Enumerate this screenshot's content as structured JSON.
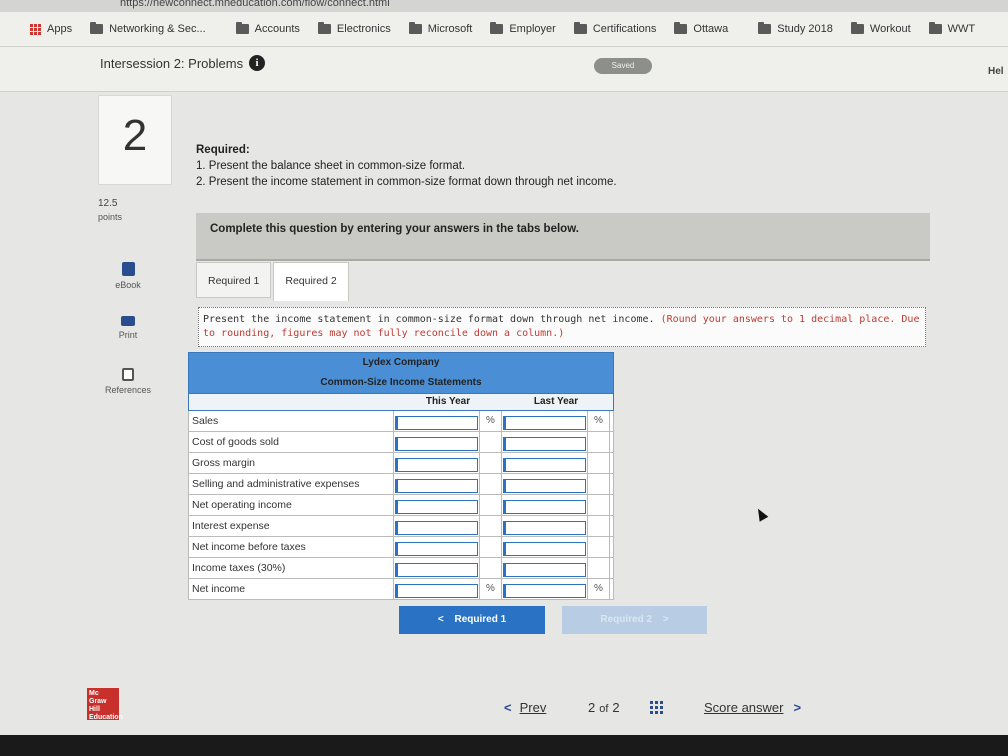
{
  "browser": {
    "url_fragment": "https://newconnect.mheducation.com/flow/connect.html",
    "bookmarks": [
      "Apps",
      "Networking & Sec...",
      "Accounts",
      "Electronics",
      "Microsoft",
      "Employer",
      "Certifications",
      "Ottawa",
      "Study 2018",
      "Workout",
      "WWT"
    ]
  },
  "header": {
    "title": "Intersession 2: Problems",
    "info_glyph": "i",
    "saved_label": "Saved",
    "help_label": "Hel"
  },
  "question": {
    "number": "2",
    "points_value": "12.5",
    "points_label": "points"
  },
  "tools": [
    {
      "label": "eBook",
      "icon": "ebook-icon"
    },
    {
      "label": "Print",
      "icon": "print-icon"
    },
    {
      "label": "References",
      "icon": "references-icon"
    }
  ],
  "required": {
    "heading": "Required:",
    "items": [
      "1. Present the balance sheet in common-size format.",
      "2. Present the income statement in common-size format down through net income."
    ]
  },
  "banner": "Complete this question by entering your answers in the tabs below.",
  "tabs": [
    "Required 1",
    "Required 2"
  ],
  "instruction": {
    "main": "Present the income statement in common-size format down through net income.",
    "note": "(Round your answers to 1 decimal place. Due to rounding, figures may not fully reconcile down a column.)"
  },
  "table": {
    "company": "Lydex Company",
    "title": "Common-Size Income Statements",
    "col_this_year": "This Year",
    "col_last_year": "Last Year",
    "pct_symbol": "%",
    "rows": [
      {
        "label": "Sales",
        "this_year": "",
        "last_year": "",
        "this_pct": "%",
        "last_pct": "%"
      },
      {
        "label": "Cost of goods sold",
        "this_year": "",
        "last_year": "",
        "this_pct": "",
        "last_pct": ""
      },
      {
        "label": "Gross margin",
        "this_year": "",
        "last_year": "",
        "this_pct": "",
        "last_pct": ""
      },
      {
        "label": "Selling and administrative expenses",
        "this_year": "",
        "last_year": "",
        "this_pct": "",
        "last_pct": ""
      },
      {
        "label": "Net operating income",
        "this_year": "",
        "last_year": "",
        "this_pct": "",
        "last_pct": ""
      },
      {
        "label": "Interest expense",
        "this_year": "",
        "last_year": "",
        "this_pct": "",
        "last_pct": ""
      },
      {
        "label": "Net income before taxes",
        "this_year": "",
        "last_year": "",
        "this_pct": "",
        "last_pct": ""
      },
      {
        "label": "Income taxes (30%)",
        "this_year": "",
        "last_year": "",
        "this_pct": "",
        "last_pct": ""
      },
      {
        "label": "Net income",
        "this_year": "",
        "last_year": "",
        "this_pct": "%",
        "last_pct": "%"
      }
    ]
  },
  "buttons": {
    "prev_tab": "Required 1",
    "next_tab": "Required 2"
  },
  "footer": {
    "logo_text": "Mc Graw Hill Education",
    "prev_label": "Prev",
    "current_page": "2",
    "of_label": "of",
    "total_pages": "2",
    "score_label": "Score answer"
  },
  "colors": {
    "accent_blue": "#2a73c4",
    "table_header_blue": "#4a8fd6",
    "logo_red": "#c8302b",
    "instruction_red": "#c03a32"
  }
}
